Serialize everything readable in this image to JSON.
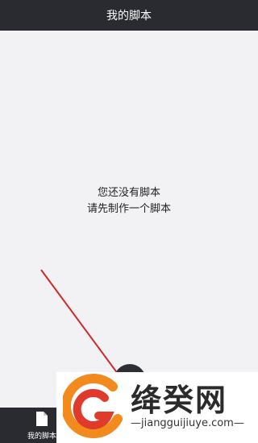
{
  "header": {
    "title": "我的脚本"
  },
  "empty_state": {
    "line1": "您还没有脚本",
    "line2": "请先制作一个脚本"
  },
  "bottom_nav": {
    "items": [
      {
        "label": "我的脚本",
        "icon": "document-icon"
      }
    ]
  },
  "fab": {
    "icon": "add-icon"
  },
  "watermark": {
    "title": "绛癸网",
    "url": "jiangguijiuye.com"
  },
  "colors": {
    "bar": "#2a2b30",
    "background": "#f2f2f4",
    "annotation": "#cc2a2a",
    "logo_orange": "#f28a1e",
    "logo_red": "#e03a2a"
  }
}
